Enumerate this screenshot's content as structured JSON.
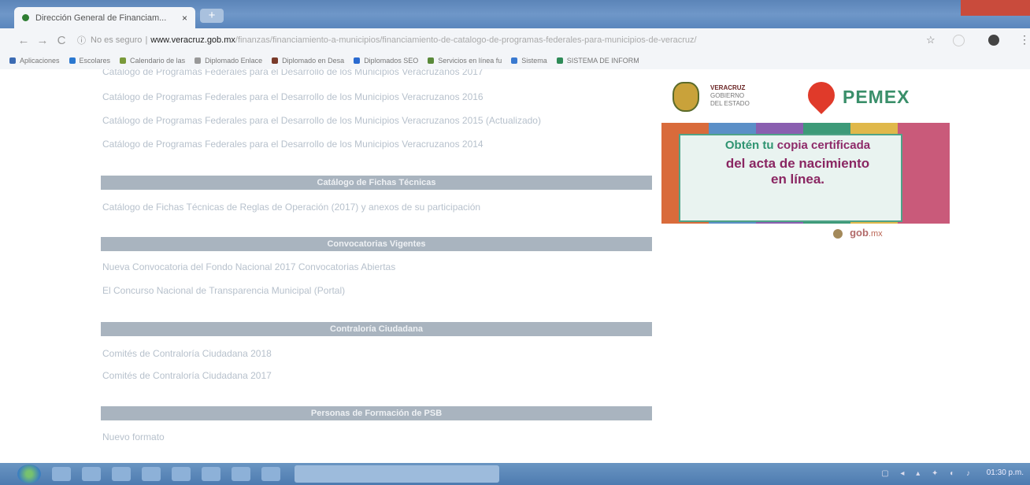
{
  "browser": {
    "tab_title": "Dirección General de Financiam...",
    "tab_close": "×",
    "new_tab": "+",
    "nav": {
      "back": "←",
      "forward": "→",
      "reload": "C"
    },
    "url_info_icon": "ⓘ",
    "url_insecure": "No es seguro",
    "url_domain": "www.veracruz.gob.mx",
    "url_path": "/finanzas/financiamiento-a-municipios/financiamiento-de-catalogo-de-programas-federales-para-municipios-de-veracruz/",
    "star": "☆",
    "menu": "⋮"
  },
  "bookmarks": [
    {
      "label": "Aplicaciones",
      "icon": "apps-icon",
      "color": "#3b6bb3"
    },
    {
      "label": "Escolares",
      "icon": "bookmark-icon",
      "color": "#2a78d0"
    },
    {
      "label": "Calendario de las",
      "icon": "calendar-icon",
      "color": "#7a9a3a"
    },
    {
      "label": "Diplomado Enlace",
      "icon": "folder-icon",
      "color": "#999999"
    },
    {
      "label": "Diplomado en Desa",
      "icon": "diploma-icon",
      "color": "#7a3a2a"
    },
    {
      "label": "Diplomados SEO",
      "icon": "seo-icon",
      "color": "#2a6ad0"
    },
    {
      "label": "Servicios en línea fu",
      "icon": "services-icon",
      "color": "#5a8a3a"
    },
    {
      "label": "Sistema",
      "icon": "system-icon",
      "color": "#3a7ad0"
    },
    {
      "label": "SISTEMA DE INFORM",
      "icon": "info-system-icon",
      "color": "#2e8b57"
    }
  ],
  "main": {
    "links_top": [
      "Catálogo de Programas Federales para el Desarrollo de los Municipios Veracruzanos 2016",
      "Catálogo de Programas Federales para el Desarrollo de los Municipios Veracruzanos 2015 (Actualizado)",
      "Catálogo de Programas Federales para el Desarrollo de los Municipios Veracruzanos 2014"
    ],
    "section_fichas": "Catálogo de Fichas Técnicas",
    "link_fichas": "Catálogo de Fichas Técnicas de Reglas de Operación (2017) y anexos de su participación",
    "section_convocatorias": "Convocatorias Vigentes",
    "link_conv1": "Nueva Convocatoria del Fondo Nacional 2017 Convocatorias Abiertas",
    "link_conv2": "El Concurso Nacional de Transparencia Municipal (Portal)",
    "section_contraloria": "Contraloría Ciudadana",
    "link_contra1": "Comités de Contraloría Ciudadana 2018",
    "link_contra2": "Comités de Contraloría Ciudadana 2017",
    "section_ferti": "Personas de Formación de PSB",
    "link_ferti": "Nuevo formato"
  },
  "sidebar": {
    "vz_line1": "VERACRUZ",
    "vz_line2": "GOBIERNO",
    "vz_line3": "DEL ESTADO",
    "pemex": "PEMEX",
    "banner_line1_a": "Obtén tu",
    "banner_line1_b": " copia certificada",
    "banner_line2": "del acta de nacimiento",
    "banner_line3": "en línea.",
    "mini_gob": "gob",
    "mini_mx": ".mx"
  },
  "taskbar": {
    "tray_icons": "▢ ◂ ▴ ✦ ◐ ♪",
    "clock": "01:30 p.m."
  }
}
